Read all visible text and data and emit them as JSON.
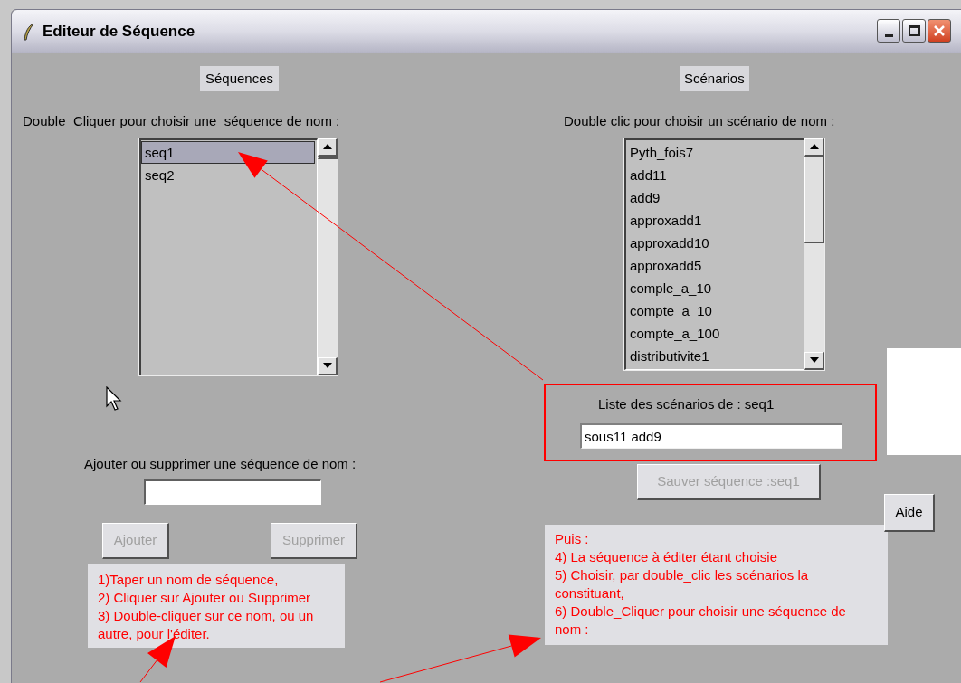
{
  "window": {
    "title": "Editeur de Séquence"
  },
  "sequences": {
    "heading": "Séquences",
    "instruction": "Double_Cliquer pour choisir une  séquence de nom :",
    "items": [
      {
        "label": "seq1",
        "selected": true
      },
      {
        "label": "seq2",
        "selected": false
      }
    ]
  },
  "add_remove": {
    "label": "Ajouter ou supprimer une séquence de nom :",
    "buttons": [
      {
        "label": "Ajouter",
        "disabled": true
      },
      {
        "label": "Supprimer",
        "disabled": true
      }
    ]
  },
  "help_left": [
    "1)Taper un nom de séquence,",
    "2) Cliquer sur Ajouter ou Supprimer",
    "3) Double-cliquer sur ce nom, ou un",
    "autre, pour l'éditer."
  ],
  "scenarios": {
    "heading": "Scénarios",
    "instruction": "Double clic pour choisir un scénario de nom :",
    "items": [
      {
        "label": "Pyth_fois7",
        "selected": false
      },
      {
        "label": "add11",
        "selected": false
      },
      {
        "label": "add9",
        "selected": false
      },
      {
        "label": "approxadd1",
        "selected": false
      },
      {
        "label": "approxadd10",
        "selected": false
      },
      {
        "label": "approxadd5",
        "selected": false
      },
      {
        "label": "comple_a_10",
        "selected": false
      },
      {
        "label": "compte_a_10",
        "selected": false
      },
      {
        "label": "compte_a_100",
        "selected": false
      },
      {
        "label": "distributivite1",
        "selected": false
      }
    ]
  },
  "scenario_list": {
    "label": "Liste des scénarios de : seq1",
    "value": "sous11 add9"
  },
  "save_button": {
    "label": "Sauver séquence :seq1",
    "disabled": true
  },
  "help_button": {
    "label": "Aide",
    "disabled": false
  },
  "help_right": [
    "Puis :",
    "4) La séquence à éditer étant choisie",
    "5) Choisir, par double_clic les scénarios la",
    "constituant,",
    "6) Double_Cliquer pour choisir une  séquence de",
    "nom :"
  ]
}
